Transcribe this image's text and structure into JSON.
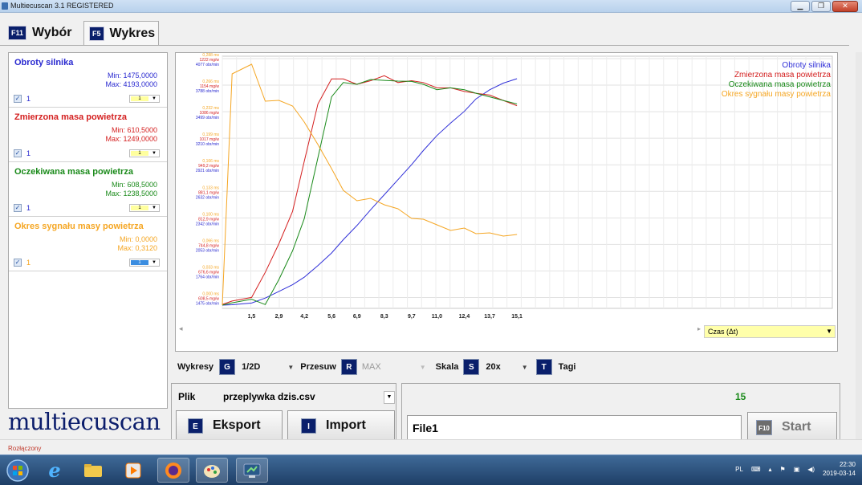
{
  "window": {
    "title": "Multiecuscan 3.1 REGISTERED"
  },
  "tabs": [
    {
      "key": "F11",
      "label": "Wybór"
    },
    {
      "key": "F5",
      "label": "Wykres"
    }
  ],
  "sensors": [
    {
      "name": "Obroty silnika",
      "min": "Min: 1475,0000",
      "max": "Max: 4193,0000",
      "check_label": "1",
      "color": "#2a2ad0"
    },
    {
      "name": "Zmierzona masa powietrza",
      "min": "Min: 610,5000",
      "max": "Max: 1249,0000",
      "check_label": "1",
      "color": "#d42020"
    },
    {
      "name": "Oczekiwana masa powietrza",
      "min": "Min: 608,5000",
      "max": "Max: 1238,5000",
      "check_label": "1",
      "color": "#1a8a1a"
    },
    {
      "name": "Okres sygnału masy powietrza",
      "min": "Min: 0,0000",
      "max": "Max: 0,3120",
      "check_label": "1",
      "color": "#f5a623"
    }
  ],
  "logo": "multiecuscan",
  "chart_data": {
    "type": "line",
    "x": [
      0,
      0.5,
      1.5,
      2.2,
      2.9,
      3.6,
      4.2,
      4.9,
      5.6,
      6.2,
      6.9,
      7.6,
      8.3,
      9.0,
      9.7,
      10.3,
      11.0,
      11.7,
      12.4,
      13.0,
      13.7,
      14.4,
      15.1
    ],
    "xticks": [
      "1,5",
      "2,9",
      "4,2",
      "5,6",
      "6,9",
      "8,3",
      "9,7",
      "11,0",
      "12,4",
      "13,7",
      "15,1"
    ],
    "xlim": [
      0,
      16.1
    ],
    "series": [
      {
        "name": "Obroty silnika",
        "color": "#3030d8",
        "ylim": [
          1475,
          4366
        ],
        "values": [
          1475,
          1480,
          1500,
          1560,
          1640,
          1720,
          1810,
          1950,
          2100,
          2260,
          2430,
          2620,
          2800,
          2980,
          3160,
          3330,
          3510,
          3660,
          3800,
          3950,
          4060,
          4140,
          4193
        ]
      },
      {
        "name": "Zmierzona masa powietrza",
        "color": "#d42020",
        "ylim": [
          608.5,
          1281
        ],
        "values": [
          610.5,
          620,
          630,
          700,
          780,
          870,
          1010,
          1170,
          1240,
          1240,
          1225,
          1235,
          1249,
          1230,
          1235,
          1230,
          1215,
          1215,
          1205,
          1200,
          1195,
          1180,
          1165
        ]
      },
      {
        "name": "Oczekiwana masa powietrza",
        "color": "#1a8a1a",
        "ylim": [
          608.5,
          1281
        ],
        "values": [
          608.5,
          615,
          625,
          610,
          680,
          760,
          850,
          1020,
          1190,
          1230,
          1225,
          1238.5,
          1236,
          1234,
          1233,
          1225,
          1210,
          1215,
          1210,
          1200,
          1190,
          1180,
          1170
        ]
      },
      {
        "name": "Okres sygnału masy powietrza",
        "color": "#f5a623",
        "ylim": [
          0,
          0.3
        ],
        "values": [
          0.0,
          0.288,
          0.3,
          0.254,
          0.255,
          0.248,
          0.228,
          0.2,
          0.17,
          0.143,
          0.13,
          0.133,
          0.125,
          0.12,
          0.108,
          0.107,
          0.1,
          0.093,
          0.096,
          0.089,
          0.09,
          0.086,
          0.088
        ]
      }
    ],
    "left_axis_labels": [
      [
        "0,288 ms",
        "1222 mg/w",
        "4077 obr/min"
      ],
      [
        "0,266 ms",
        "1154 mg/w",
        "3788 obr/min"
      ],
      [
        "0,232 ms",
        "1086 mg/w",
        "3499 obr/min"
      ],
      [
        "0,199 ms",
        "1017 mg/w",
        "3210 obr/min"
      ],
      [
        "0,166 ms",
        "949,2 mg/w",
        "2921 obr/min"
      ],
      [
        "0,133 ms",
        "881,1 mg/w",
        "2632 obr/min"
      ],
      [
        "0,100 ms",
        "812,9 mg/w",
        "2342 obr/min"
      ],
      [
        "0,066 ms",
        "744,8 mg/w",
        "2053 obr/min"
      ],
      [
        "0,033 ms",
        "676,6 mg/w",
        "1764 obr/min"
      ],
      [
        "0,000 ms",
        "608,5 mg/w",
        "1475 obr/min"
      ]
    ],
    "legend_position": "top-right",
    "grid": true
  },
  "time_axis": {
    "label": "Czas (Δt)"
  },
  "controls": {
    "wykresy_label": "Wykresy",
    "wykresy_key": "G",
    "wykresy_value": "1/2D",
    "przesuw_label": "Przesuw",
    "przesuw_key": "R",
    "przesuw_value": "MAX",
    "skala_label": "Skala",
    "skala_key": "S",
    "skala_value": "20x",
    "tagi_key": "T",
    "tagi_label": "Tagi"
  },
  "file_panel": {
    "plik_label": "Plik",
    "file_value": "przeplywka dzis.csv",
    "export_key": "E",
    "export_label": "Eksport",
    "import_key": "I",
    "import_label": "Import"
  },
  "record_panel": {
    "counter": "15",
    "filename": "File1",
    "start_key": "F10",
    "start_label": "Start"
  },
  "status": {
    "text": "Rozłączony"
  },
  "taskbar": {
    "lang": "PL",
    "time": "22:30",
    "date": "2019-03-14"
  }
}
